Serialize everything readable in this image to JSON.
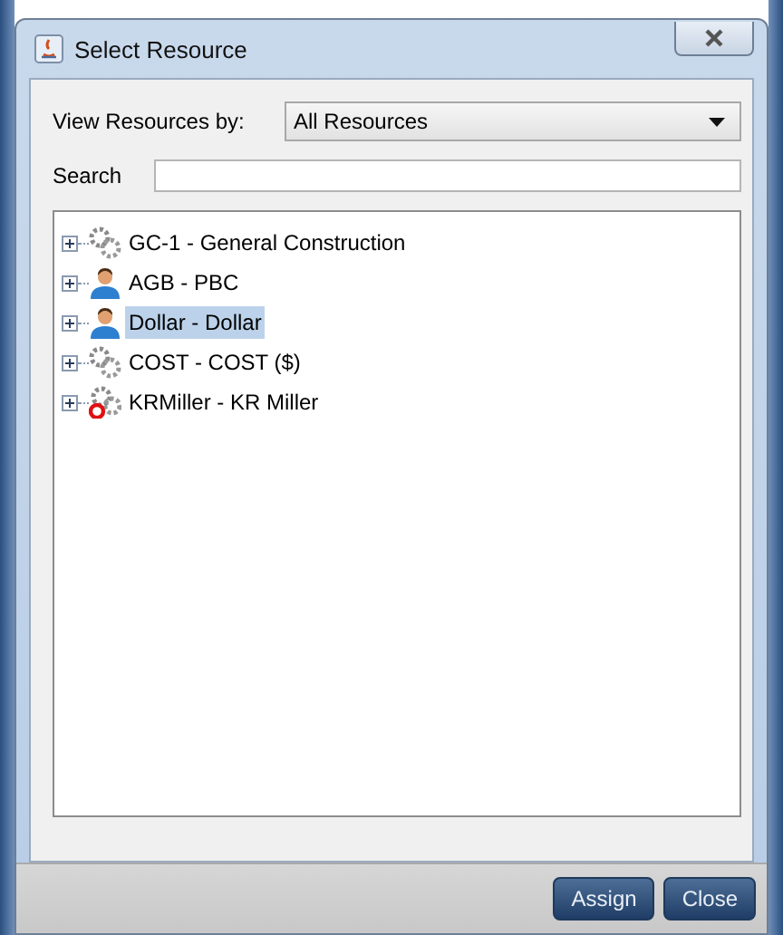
{
  "window": {
    "title": "Select Resource"
  },
  "view_by": {
    "label": "View Resources by:",
    "value": "All Resources"
  },
  "search": {
    "label": "Search"
  },
  "tree": {
    "items": [
      {
        "label": "GC-1 - General Construction",
        "kind": "group",
        "selected": false
      },
      {
        "label": "AGB - PBC",
        "kind": "person",
        "selected": false
      },
      {
        "label": "Dollar - Dollar",
        "kind": "person",
        "selected": true
      },
      {
        "label": "COST - COST ($)",
        "kind": "group",
        "selected": false
      },
      {
        "label": "KRMiller - KR Miller",
        "kind": "locked-group",
        "selected": false
      }
    ]
  },
  "buttons": [
    "Assign",
    "Close"
  ]
}
